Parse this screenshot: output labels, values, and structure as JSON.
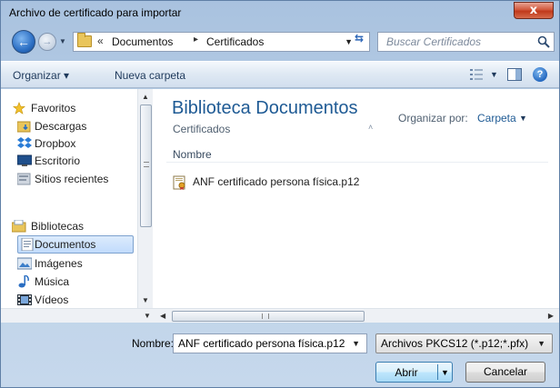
{
  "window": {
    "title": "Archivo de certificado para importar",
    "close_label": "x"
  },
  "address": {
    "chevron": "«",
    "crumbs": [
      "Documentos",
      "Certificados"
    ],
    "separator": "▸",
    "search_placeholder": "Buscar Certificados"
  },
  "toolbar": {
    "organize_label": "Organizar ▾",
    "new_folder_label": "Nueva carpeta",
    "help_label": "?"
  },
  "nav": {
    "items": [
      {
        "label": "Favoritos",
        "icon": "star-icon"
      },
      {
        "label": "Descargas",
        "icon": "downloads-folder-icon"
      },
      {
        "label": "Dropbox",
        "icon": "dropbox-icon"
      },
      {
        "label": "Escritorio",
        "icon": "desktop-icon"
      },
      {
        "label": "Sitios recientes",
        "icon": "recent-places-icon"
      },
      {
        "label": "Bibliotecas",
        "icon": "libraries-icon"
      },
      {
        "label": "Documentos",
        "icon": "documents-icon"
      },
      {
        "label": "Imágenes",
        "icon": "pictures-icon"
      },
      {
        "label": "Música",
        "icon": "music-icon"
      },
      {
        "label": "Vídeos",
        "icon": "videos-icon"
      }
    ],
    "selected": "Documentos"
  },
  "content": {
    "library_title": "Biblioteca Documentos",
    "library_subtitle": "Certificados",
    "organize_by_label": "Organizar por:",
    "organize_by_value": "Carpeta",
    "column_header": "Nombre",
    "files": [
      {
        "name": "ANF certificado persona física.p12",
        "icon": "certificate-file-icon"
      }
    ]
  },
  "footer": {
    "filename_label": "Nombre:",
    "filename_value": "ANF certificado persona física.p12",
    "filter_value": "Archivos PKCS12 (*.p12;*.pfx)",
    "open_label": "Abrir",
    "cancel_label": "Cancelar"
  },
  "colors": {
    "accent_title": "#1e5a94",
    "close_button": "#c0391b",
    "selection": "#c1dbfc"
  }
}
